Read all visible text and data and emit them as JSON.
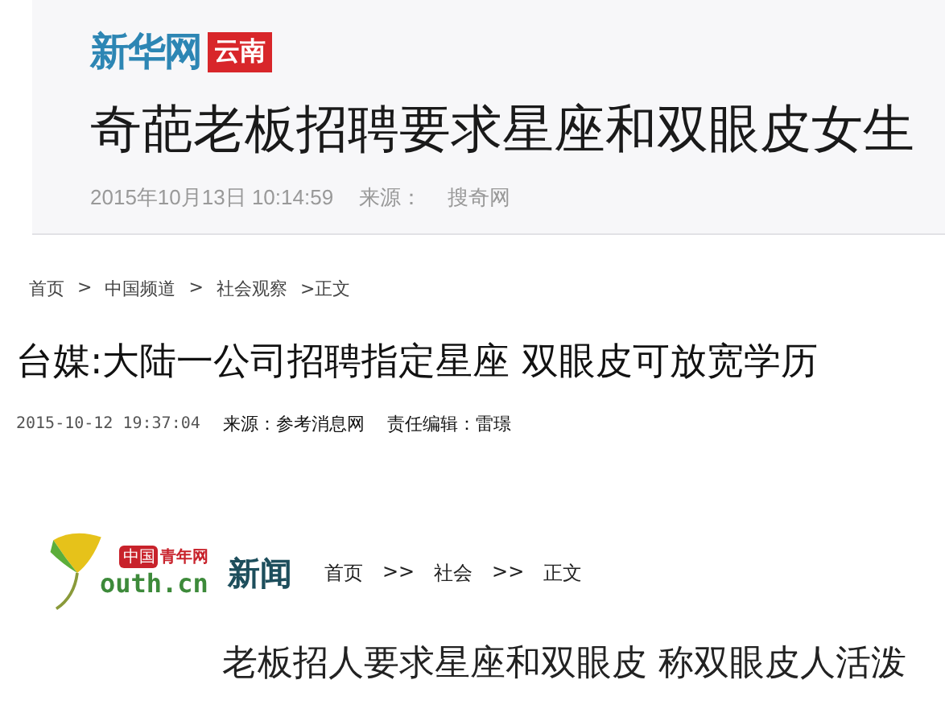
{
  "articles": [
    {
      "kind": "xinhua",
      "logo": {
        "name": "新华网",
        "region": "云南"
      },
      "title": "奇葩老板招聘要求星座和双眼皮女生",
      "meta": [
        "2015年10月13日 10:14:59",
        "来源：",
        "搜奇网"
      ]
    },
    {
      "kind": "cankao",
      "crumbs": [
        "首页",
        ">",
        "中国频道",
        ">",
        "社会观察",
        ">正文"
      ],
      "title": "台媒:大陆一公司招聘指定星座 双眼皮可放宽学历",
      "meta": [
        "2015-10-12 19:37:04",
        "来源：参考消息网",
        "责任编辑：雷璟"
      ]
    },
    {
      "kind": "youth",
      "logo": {
        "badge": "中国",
        "name": "青年网",
        "domain": "outh.cn",
        "section": "新闻"
      },
      "crumbs": [
        "首页",
        ">>",
        "社会",
        ">>",
        "正文"
      ],
      "title": "老板招人要求星座和双眼皮 称双眼皮人活泼"
    }
  ]
}
